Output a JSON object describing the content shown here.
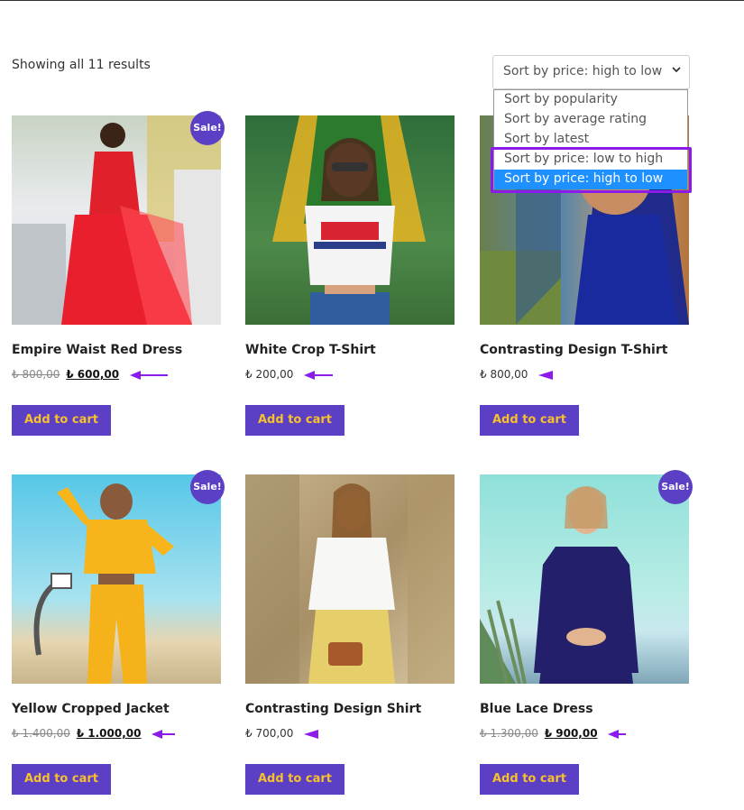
{
  "result_count": "Showing all 11 results",
  "sort": {
    "selected": "Sort by price: high to low",
    "options": [
      "Sort by popularity",
      "Sort by average rating",
      "Sort by latest",
      "Sort by price: low to high",
      "Sort by price: high to low"
    ]
  },
  "sale_badge": "Sale!",
  "cart_label": "Add to cart",
  "colors": {
    "accent": "#5b3fc4",
    "button_text": "#f6c12d",
    "highlight": "#8a1bea",
    "selected_option": "#1e90ff"
  },
  "products": [
    {
      "name": "Empire Waist Red Dress",
      "old_price": "₺ 800,00",
      "price": "₺ 600,00",
      "sale": true
    },
    {
      "name": "White Crop T-Shirt",
      "old_price": "",
      "price": "₺ 200,00",
      "sale": false
    },
    {
      "name": "Contrasting Design T-Shirt",
      "old_price": "",
      "price": "₺ 800,00",
      "sale": false
    },
    {
      "name": "Yellow Cropped Jacket",
      "old_price": "₺ 1.400,00",
      "price": "₺ 1.000,00",
      "sale": true
    },
    {
      "name": "Contrasting Design Shirt",
      "old_price": "",
      "price": "₺ 700,00",
      "sale": false
    },
    {
      "name": "Blue Lace Dress",
      "old_price": "₺ 1.300,00",
      "price": "₺ 900,00",
      "sale": true
    }
  ]
}
